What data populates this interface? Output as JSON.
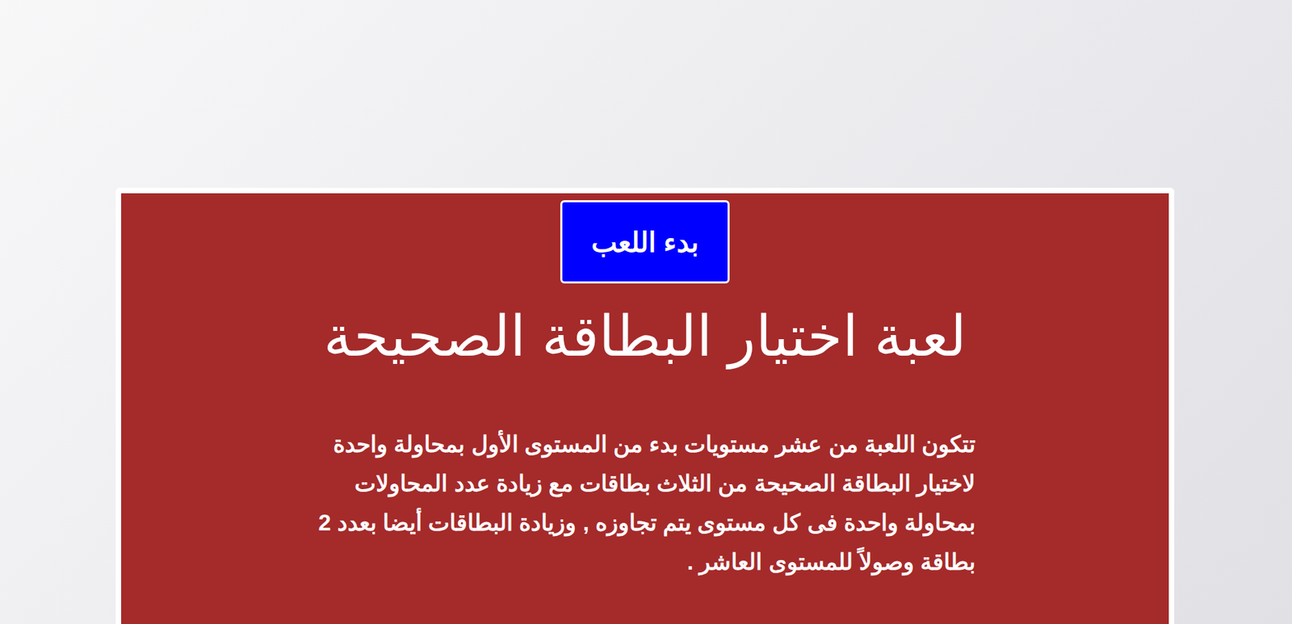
{
  "start_button": "بدء اللعب",
  "title": "لعبة اختيار البطاقة الصحيحة",
  "description": "تتكون اللعبة من عشر مستويات بدء من المستوى الأول بمحاولة واحدة لاختيار البطاقة الصحيحة من الثلاث بطاقات مع زيادة عدد المحاولات بمحاولة واحدة فى كل مستوى يتم تجاوزه , وزيادة البطاقات أيضا بعدد 2 بطاقة وصولاً للمستوى العاشر ."
}
